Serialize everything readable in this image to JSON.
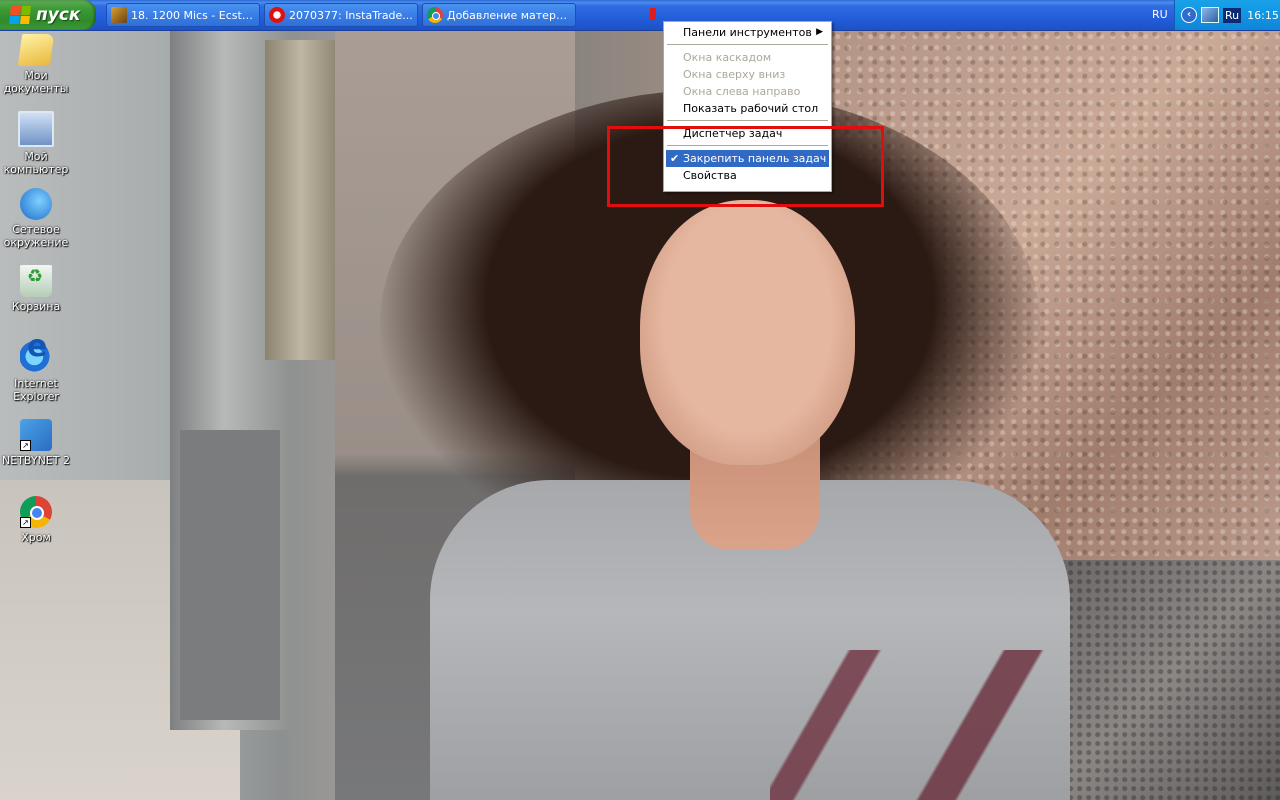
{
  "taskbar": {
    "start_label": "пуск",
    "tasks": [
      {
        "label": "18. 1200 Mics - Ecsta...",
        "icon": "winamp-icon"
      },
      {
        "label": "2070377: InstaTrade...",
        "icon": "instatrade-icon"
      },
      {
        "label": "Добавление матери...",
        "icon": "chrome-icon"
      }
    ],
    "language": "RU",
    "tray_language": "Ru",
    "clock": "16:15"
  },
  "desktop_icons": [
    {
      "label": "Мои документы",
      "icon": "my-documents-icon"
    },
    {
      "label": "Мой компьютер",
      "icon": "my-computer-icon"
    },
    {
      "label": "Сетевое окружение",
      "icon": "network-places-icon"
    },
    {
      "label": "Корзина",
      "icon": "recycle-bin-icon"
    },
    {
      "label": "Internet Explorer",
      "icon": "internet-explorer-icon"
    },
    {
      "label": "NETBYNET 2",
      "icon": "netbynet-icon"
    },
    {
      "label": "Хром",
      "icon": "chrome-icon"
    }
  ],
  "context_menu": {
    "toolbars": "Панели инструментов",
    "cascade": "Окна каскадом",
    "tile_horizontal": "Окна сверху вниз",
    "tile_vertical": "Окна слева направо",
    "show_desktop": "Показать рабочий стол",
    "task_manager": "Диспетчер задач",
    "lock_taskbar": "Закрепить панель задач",
    "properties": "Свойства"
  },
  "colors": {
    "taskbar_blue": "#245edb",
    "start_green": "#3c9a36",
    "menu_highlight": "#316ac5",
    "annotation_red": "#e20d0d"
  }
}
